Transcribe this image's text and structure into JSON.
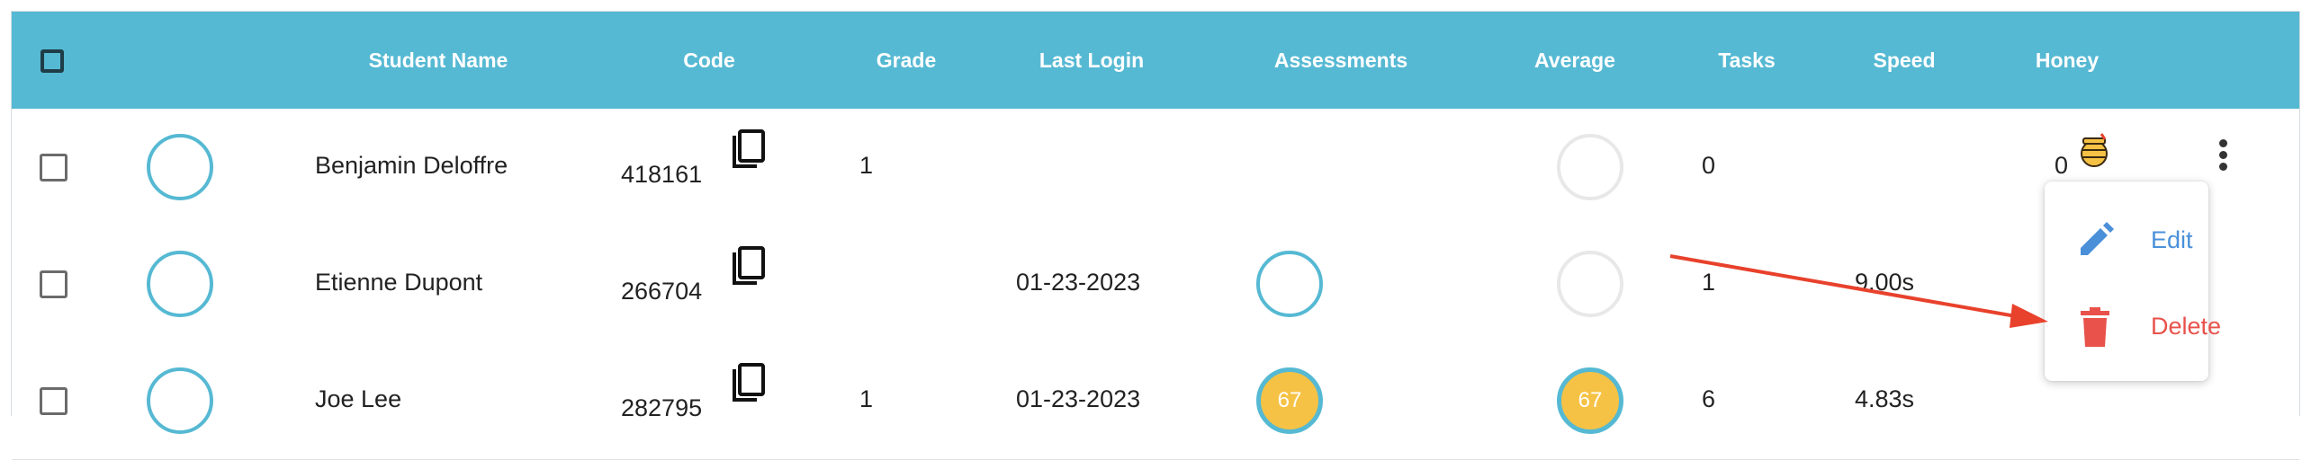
{
  "header": {
    "columns": [
      "Student Name",
      "Code",
      "Grade",
      "Last Login",
      "Assessments",
      "Average",
      "Tasks",
      "Speed",
      "Honey"
    ]
  },
  "rows": [
    {
      "name": "Benjamin Deloffre",
      "code": "418161",
      "grade": "1",
      "last_login": "",
      "assessment": "",
      "average": "",
      "tasks": "0",
      "speed": "",
      "honey": "0"
    },
    {
      "name": "Etienne Dupont",
      "code": "266704",
      "grade": "",
      "last_login": "01-23-2023",
      "assessment": "",
      "average": "",
      "tasks": "1",
      "speed": "9.00s",
      "honey": ""
    },
    {
      "name": "Joe Lee",
      "code": "282795",
      "grade": "1",
      "last_login": "01-23-2023",
      "assessment": "67",
      "average": "67",
      "tasks": "6",
      "speed": "4.83s",
      "honey": ""
    }
  ],
  "menu": {
    "edit_label": "Edit",
    "delete_label": "Delete"
  },
  "icons": {
    "copy": "copy-icon",
    "honey": "honey-pot-icon",
    "more": "kebab-menu-icon",
    "edit": "pencil-icon",
    "delete": "trash-icon"
  },
  "colors": {
    "header_bg": "#56b9d3",
    "score_fill": "#f6c245",
    "edit": "#4a90d9",
    "delete": "#e8524b",
    "annotation_arrow": "#e8412c"
  }
}
